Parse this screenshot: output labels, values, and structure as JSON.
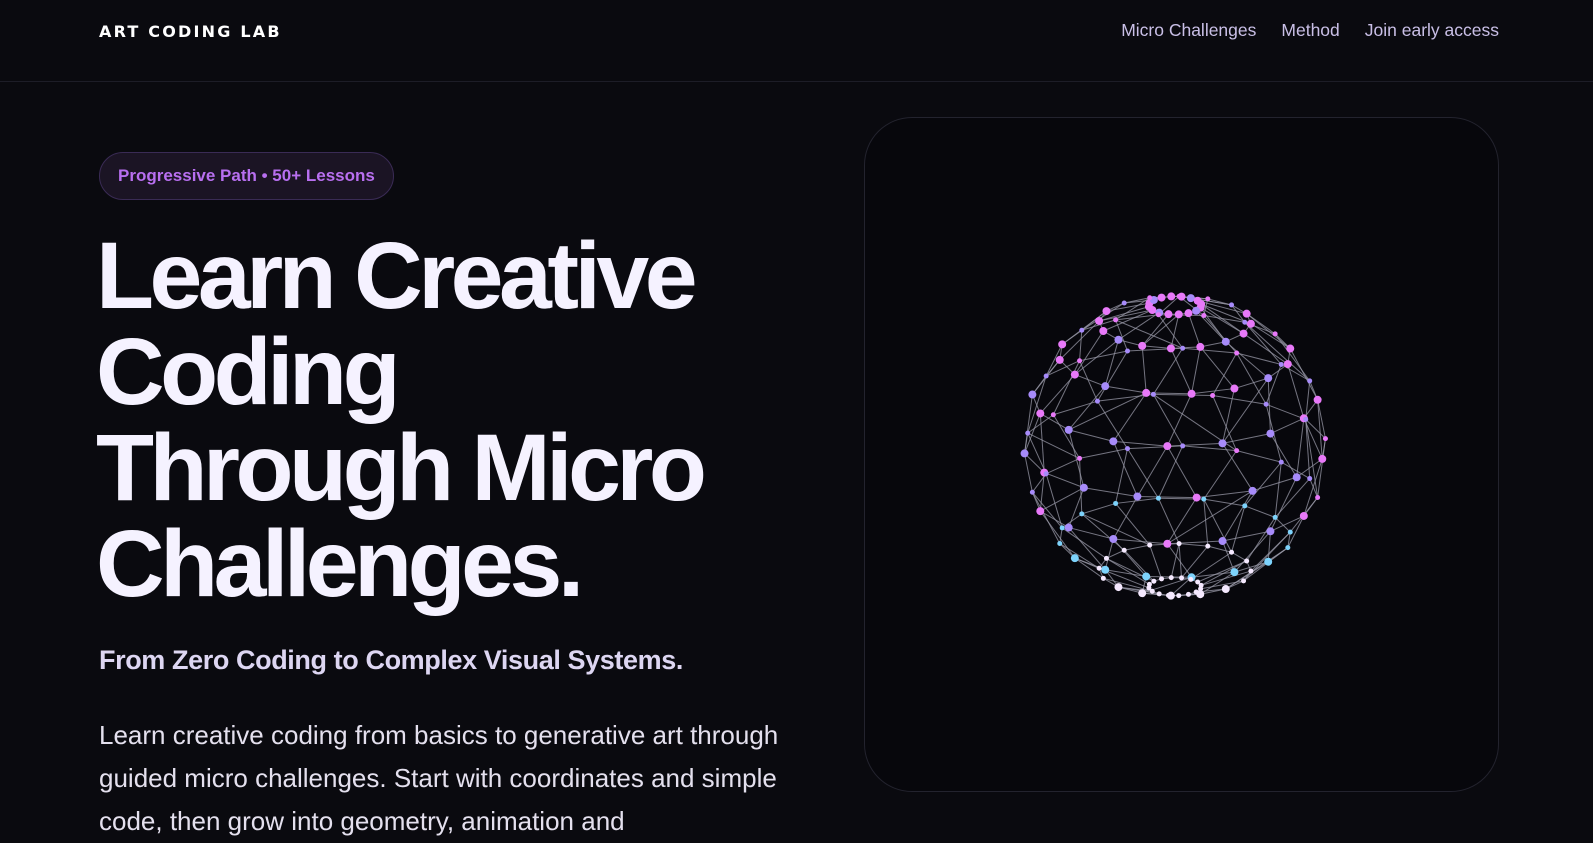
{
  "brand": "ART CODING LAB",
  "nav": {
    "items": [
      "Micro Challenges",
      "Method",
      "Join early access"
    ]
  },
  "hero": {
    "badge": "Progressive Path • 50+ Lessons",
    "headline": [
      "Learn Creative",
      "Coding",
      "Through Micro",
      "Challenges."
    ],
    "subhead": "From Zero Coding to Complex Visual Systems.",
    "description": "Learn creative coding from basics to generative art through guided micro challenges. Start with coordinates and simple code, then grow into geometry, animation and"
  },
  "visual": {
    "sphere_colors": [
      "#e879f9",
      "#a78bfa",
      "#7dd3fc",
      "#f5e9ff"
    ],
    "edge_color": "#9a9aa8"
  }
}
